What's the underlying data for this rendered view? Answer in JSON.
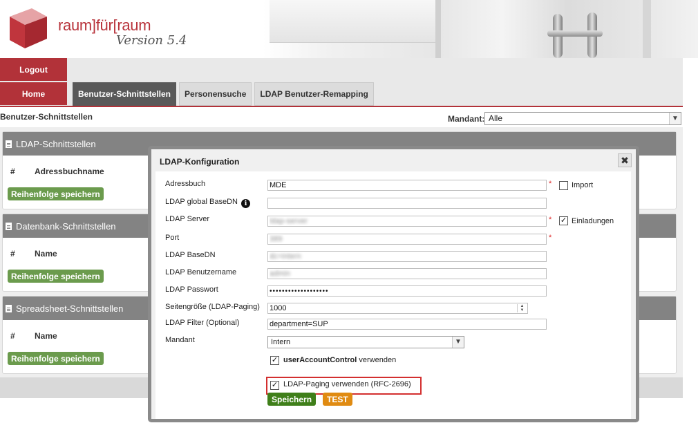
{
  "header": {
    "logo_text": "raum]für[raum",
    "version": "Version 5.4"
  },
  "nav": {
    "logout": "Logout",
    "home": "Home",
    "tabs": [
      {
        "label": "Benutzer-Schnittstellen",
        "active": true
      },
      {
        "label": "Personensuche",
        "active": false
      },
      {
        "label": "LDAP Benutzer-Remapping",
        "active": false
      }
    ]
  },
  "page": {
    "crumb": "Benutzer-Schnittstellen",
    "mandant_label": "Mandant:",
    "mandant_value": "Alle"
  },
  "panels": [
    {
      "title": "LDAP-Schnittstellen",
      "col_hash": "#",
      "col_name": "Adressbuchname",
      "save": "Reihenfolge speichern"
    },
    {
      "title": "Datenbank-Schnittstellen",
      "col_hash": "#",
      "col_name": "Name",
      "save": "Reihenfolge speichern"
    },
    {
      "title": "Spreadsheet-Schnittstellen",
      "col_hash": "#",
      "col_name": "Name",
      "save": "Reihenfolge speichern"
    }
  ],
  "modal": {
    "title": "LDAP-Konfiguration",
    "close": "✖",
    "fields": {
      "adressbuch": {
        "label": "Adressbuch",
        "value": "MDE"
      },
      "basedn_global": {
        "label": "LDAP global BaseDN",
        "value": ""
      },
      "server": {
        "label": "LDAP Server",
        "value": "ldap-server"
      },
      "port": {
        "label": "Port",
        "value": "389"
      },
      "basedn": {
        "label": "LDAP BaseDN",
        "value": "dc=intern"
      },
      "benutzername": {
        "label": "LDAP Benutzername",
        "value": "admin"
      },
      "passwort": {
        "label": "LDAP Passwort",
        "value": "•••••••••••••••••••"
      },
      "seitengroesse": {
        "label": "Seitengröße (LDAP-Paging)",
        "value": "1000"
      },
      "filter": {
        "label": "LDAP Filter (Optional)",
        "value": "department=SUP"
      },
      "mandant": {
        "label": "Mandant",
        "value": "Intern"
      }
    },
    "import_label": "Import",
    "import_checked": false,
    "einladungen_label": "Einladungen",
    "einladungen_checked": true,
    "uac_bold": "userAccountControl",
    "uac_rest": "verwenden",
    "uac_checked": true,
    "paging_label": "LDAP-Paging verwenden (RFC-2696)",
    "paging_checked": true,
    "required_mark": "*",
    "check_mark": "✓",
    "save": "Speichern",
    "test": "TEST"
  },
  "colors": {
    "brand_red": "#b23239",
    "save_green": "#3f7f1a",
    "test_orange": "#e08b12",
    "highlight_red": "#d32f2f"
  }
}
